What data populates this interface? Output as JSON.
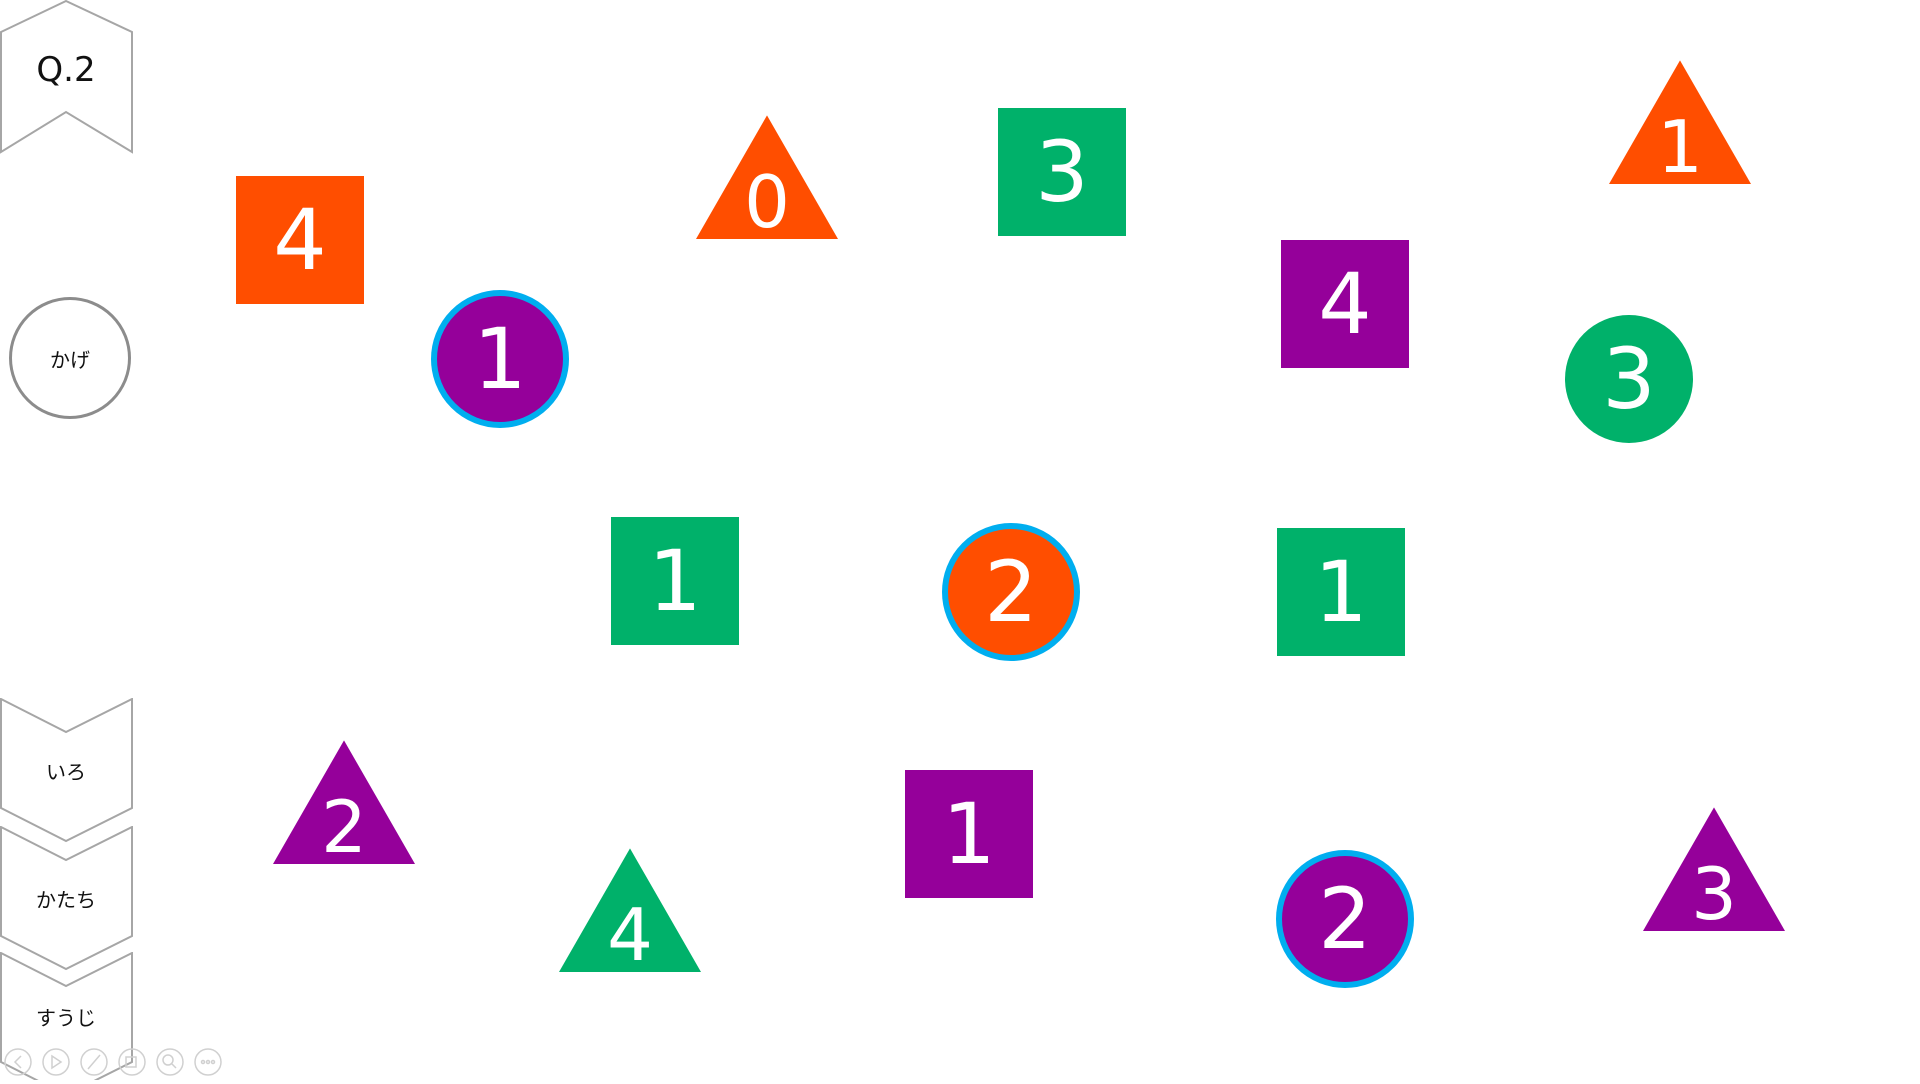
{
  "slide": {
    "question_label": "Q.2",
    "shadow_button_label": "かげ",
    "filter_buttons": [
      {
        "label": "いろ"
      },
      {
        "label": "かたち"
      },
      {
        "label": "すうじ"
      }
    ]
  },
  "colors": {
    "orange": "#FF4E00",
    "green": "#00B16A",
    "purple": "#95009A",
    "highlight": "#00AEEF",
    "outline": "#A6A6A6"
  },
  "shapes": [
    {
      "shape": "square",
      "color": "orange",
      "number": "4"
    },
    {
      "shape": "triangle",
      "color": "orange",
      "number": "0"
    },
    {
      "shape": "square",
      "color": "green",
      "number": "3"
    },
    {
      "shape": "triangle",
      "color": "orange",
      "number": "1"
    },
    {
      "shape": "circle",
      "color": "purple",
      "number": "1",
      "highlighted": true
    },
    {
      "shape": "square",
      "color": "purple",
      "number": "4"
    },
    {
      "shape": "circle",
      "color": "green",
      "number": "3"
    },
    {
      "shape": "square",
      "color": "green",
      "number": "1"
    },
    {
      "shape": "circle",
      "color": "orange",
      "number": "2",
      "highlighted": true
    },
    {
      "shape": "square",
      "color": "green",
      "number": "1"
    },
    {
      "shape": "triangle",
      "color": "purple",
      "number": "2"
    },
    {
      "shape": "square",
      "color": "purple",
      "number": "1"
    },
    {
      "shape": "triangle",
      "color": "green",
      "number": "4"
    },
    {
      "shape": "circle",
      "color": "purple",
      "number": "2",
      "highlighted": true
    },
    {
      "shape": "triangle",
      "color": "purple",
      "number": "3"
    }
  ],
  "toolbar": {
    "icons": [
      "prev-icon",
      "play-icon",
      "pen-icon",
      "slides-icon",
      "zoom-icon",
      "more-icon"
    ]
  }
}
